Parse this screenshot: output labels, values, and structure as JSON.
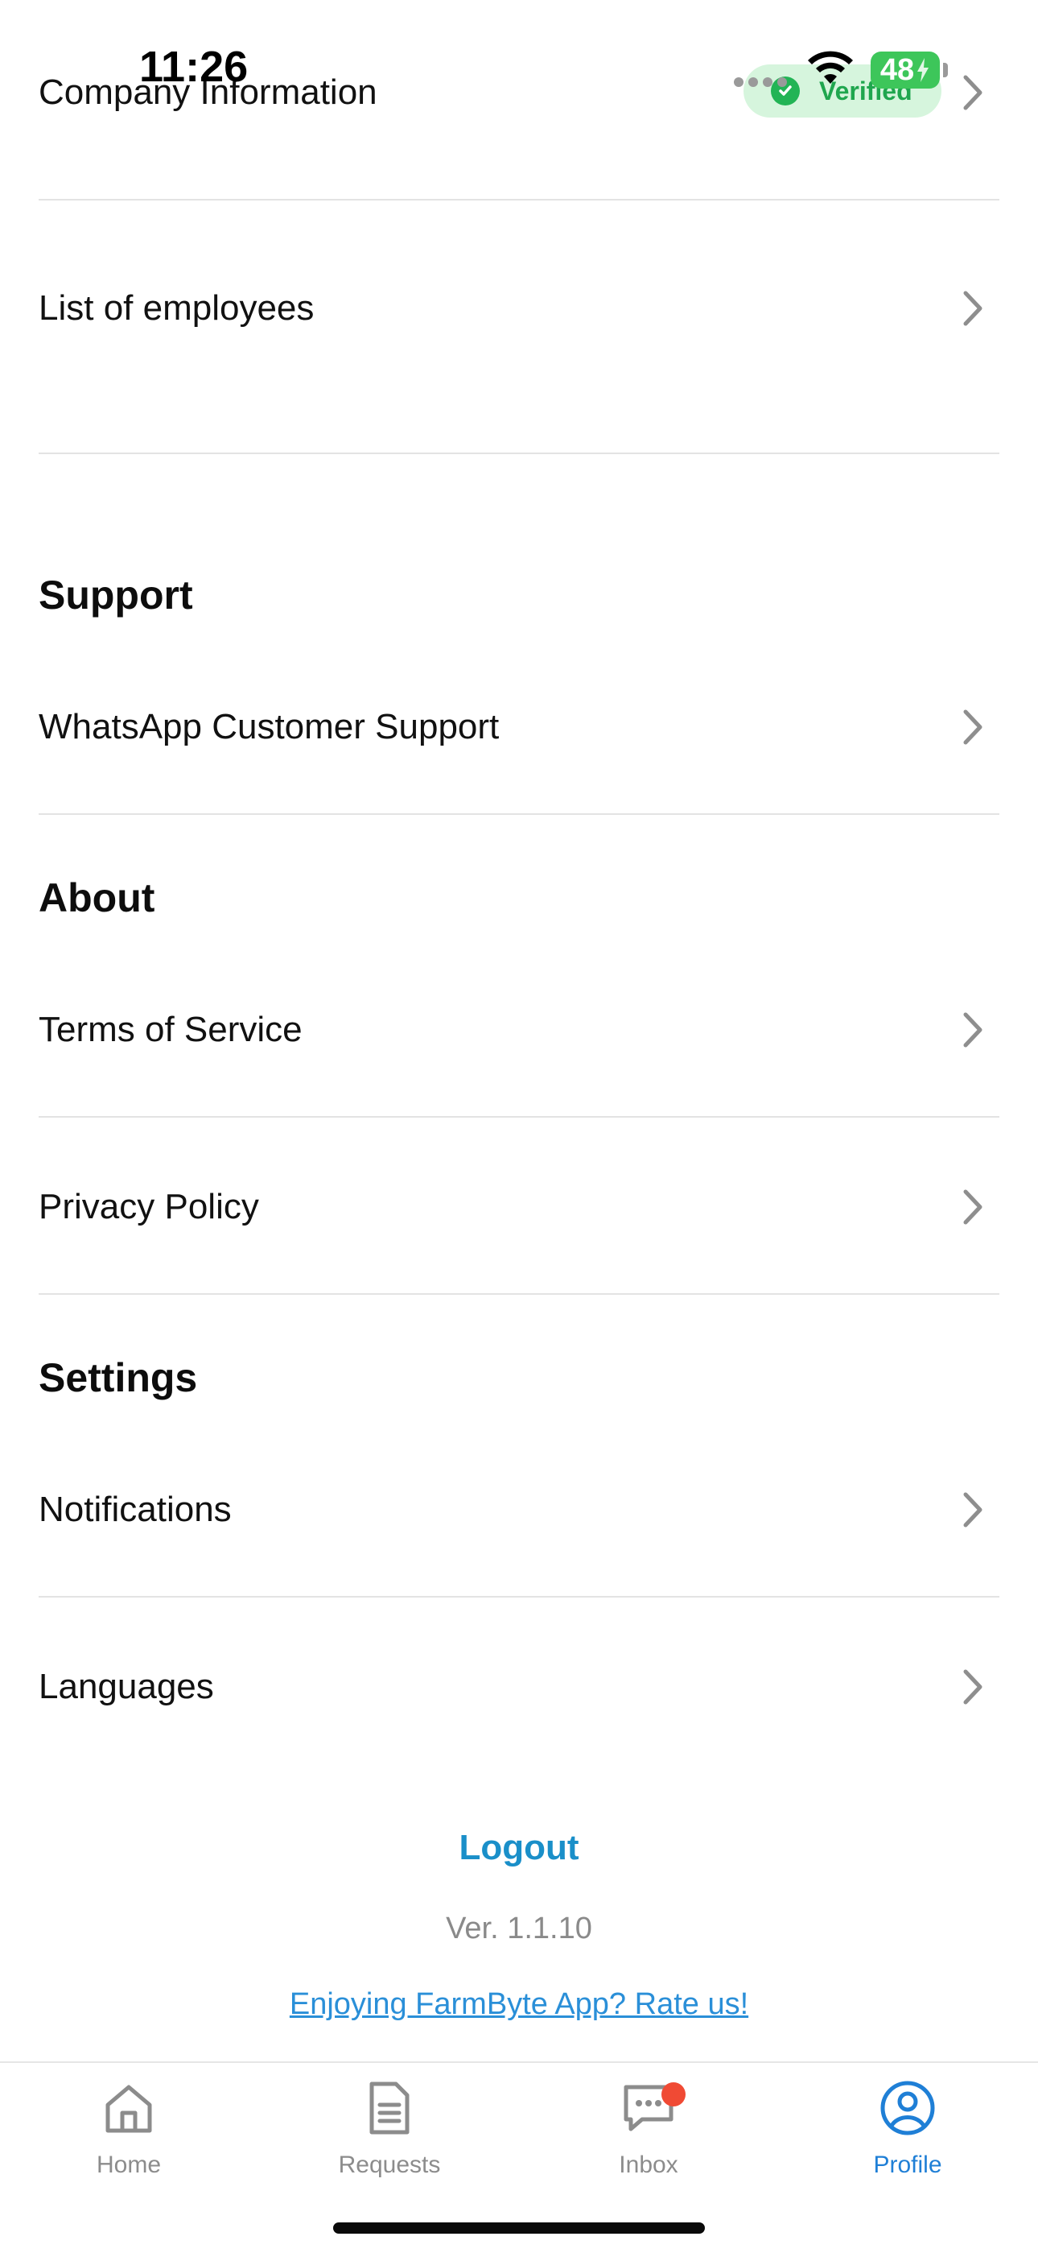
{
  "status_bar": {
    "time": "11:26",
    "battery": "48"
  },
  "company": {
    "label": "Company Information",
    "badge": "Verified"
  },
  "rows": {
    "employees": "List of employees",
    "whatsapp": "WhatsApp Customer Support",
    "terms": "Terms of Service",
    "privacy": "Privacy Policy",
    "notifications": "Notifications",
    "languages": "Languages"
  },
  "sections": {
    "support": "Support",
    "about": "About",
    "settings": "Settings"
  },
  "footer": {
    "logout": "Logout",
    "version": "Ver. 1.1.10",
    "rate": "Enjoying FarmByte App? Rate us!"
  },
  "tabs": [
    {
      "label": "Home",
      "icon": "home-icon"
    },
    {
      "label": "Requests",
      "icon": "document-icon"
    },
    {
      "label": "Inbox",
      "icon": "chat-icon"
    },
    {
      "label": "Profile",
      "icon": "user-circle-icon",
      "active": true
    }
  ],
  "colors": {
    "accent": "#1f7fd6",
    "logout": "#1a8fc9",
    "verified_bg": "#d6f5dd",
    "verified_text": "#1fa64e",
    "badge_dot": "#f04a34"
  }
}
